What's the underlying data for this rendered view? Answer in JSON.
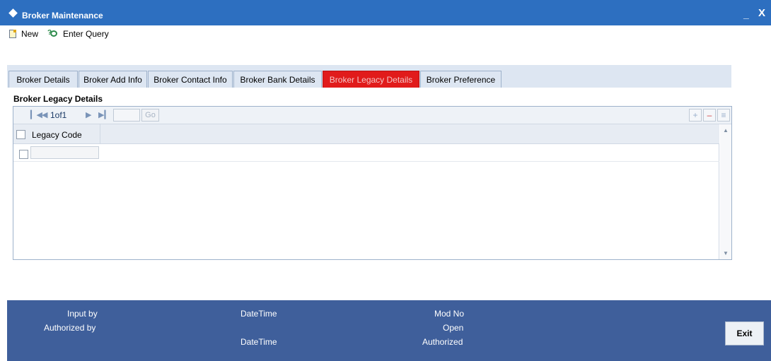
{
  "window": {
    "title": "Broker Maintenance",
    "minimize_label": "_",
    "close_label": "X"
  },
  "toolbar": {
    "new_label": "New",
    "enter_query_label": "Enter Query"
  },
  "tabs": [
    {
      "label": "Broker Details"
    },
    {
      "label": "Broker Add Info"
    },
    {
      "label": "Broker Contact Info"
    },
    {
      "label": "Broker Bank Details"
    },
    {
      "label": "Broker Legacy Details",
      "active": true
    },
    {
      "label": "Broker Preference"
    }
  ],
  "section": {
    "title": "Broker Legacy Details"
  },
  "grid": {
    "pagination": {
      "page_text": "1of1",
      "go_label": "Go"
    },
    "column_header": "Legacy Code",
    "rows": [
      {
        "legacy_code": ""
      }
    ]
  },
  "footer": {
    "input_by_label": "Input by",
    "authorized_by_label": "Authorized by",
    "datetime_label_1": "DateTime",
    "datetime_label_2": "DateTime",
    "mod_no_label": "Mod No",
    "open_label": "Open",
    "authorized_label": "Authorized",
    "exit_label": "Exit"
  },
  "colors": {
    "title_bar": "#2d6fc0",
    "active_tab": "#e11b1b",
    "footer": "#3f5f9b",
    "tab_strip": "#dde6f2"
  }
}
